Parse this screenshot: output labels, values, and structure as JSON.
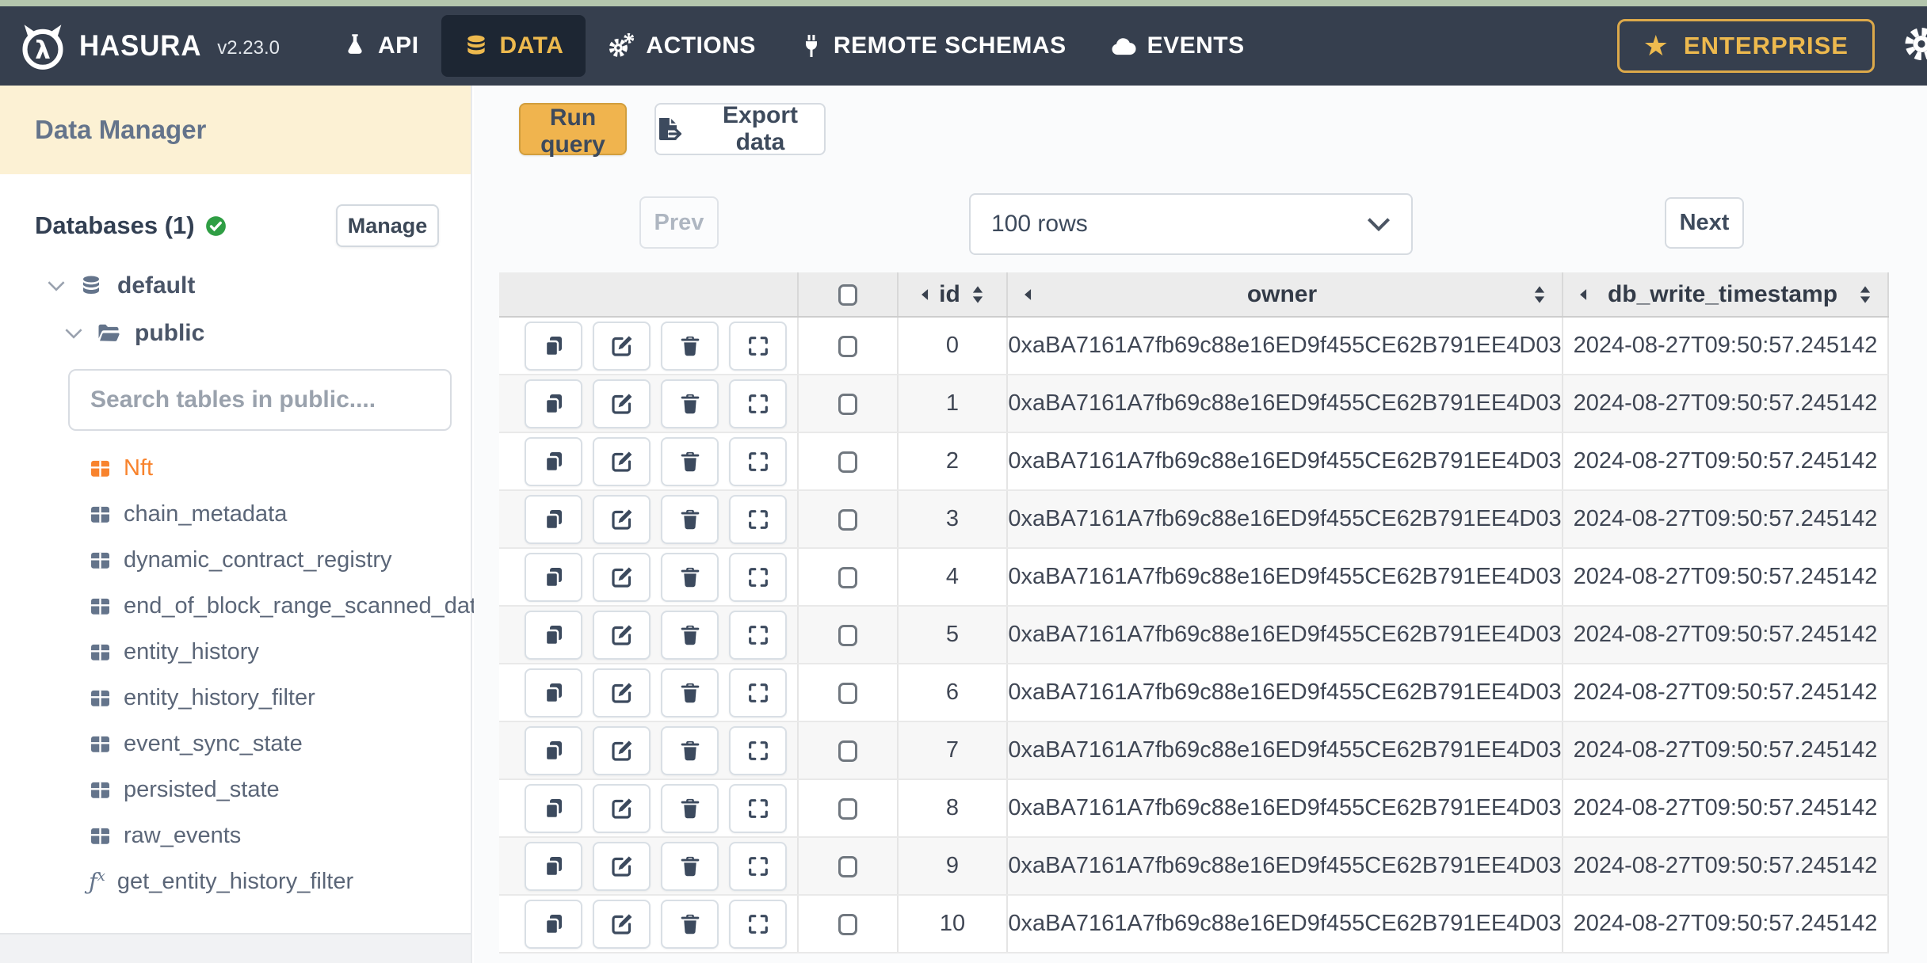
{
  "colors": {
    "accent_yellow": "#edb94e",
    "navbar_bg": "#363f4e",
    "navbar_active_bg": "#1d2633",
    "run_query_bg": "#f0b44e",
    "sidebar_header_bg": "#fcf1d4",
    "active_orange": "#f8832d",
    "success_green": "#2f9e44",
    "top_strip": "#b4c6ad"
  },
  "navbar": {
    "brand": "HASURA",
    "version": "v2.23.0",
    "items": [
      {
        "label": "API",
        "icon": "flask-icon",
        "active": false
      },
      {
        "label": "DATA",
        "icon": "database-icon",
        "active": true
      },
      {
        "label": "ACTIONS",
        "icon": "gears-icon",
        "active": false
      },
      {
        "label": "REMOTE SCHEMAS",
        "icon": "plug-icon",
        "active": false
      },
      {
        "label": "EVENTS",
        "icon": "cloud-icon",
        "active": false
      }
    ],
    "enterprise_label": "ENTERPRISE"
  },
  "sidebar": {
    "title": "Data Manager",
    "databases_label": "Databases (1)",
    "manage_label": "Manage",
    "tree": {
      "database": "default",
      "schema": "public"
    },
    "search_placeholder": "Search tables in public....",
    "tables": [
      {
        "label": "Nft",
        "icon": "table",
        "active": true
      },
      {
        "label": "chain_metadata",
        "icon": "table",
        "active": false
      },
      {
        "label": "dynamic_contract_registry",
        "icon": "table",
        "active": false
      },
      {
        "label": "end_of_block_range_scanned_data",
        "icon": "table",
        "active": false
      },
      {
        "label": "entity_history",
        "icon": "table",
        "active": false
      },
      {
        "label": "entity_history_filter",
        "icon": "table",
        "active": false
      },
      {
        "label": "event_sync_state",
        "icon": "table",
        "active": false
      },
      {
        "label": "persisted_state",
        "icon": "table",
        "active": false
      },
      {
        "label": "raw_events",
        "icon": "table",
        "active": false
      },
      {
        "label": "get_entity_history_filter",
        "icon": "function",
        "active": false
      }
    ]
  },
  "toolbar": {
    "run_query": "Run query",
    "export_data": "Export data"
  },
  "pagination": {
    "prev": "Prev",
    "rows_selected": "100 rows",
    "next": "Next"
  },
  "table": {
    "columns": [
      "id",
      "owner",
      "db_write_timestamp"
    ],
    "rows": [
      {
        "id": "0",
        "owner": "0xaBA7161A7fb69c88e16ED9f455CE62B791EE4D03",
        "db_write_timestamp": "2024-08-27T09:50:57.245142"
      },
      {
        "id": "1",
        "owner": "0xaBA7161A7fb69c88e16ED9f455CE62B791EE4D03",
        "db_write_timestamp": "2024-08-27T09:50:57.245142"
      },
      {
        "id": "2",
        "owner": "0xaBA7161A7fb69c88e16ED9f455CE62B791EE4D03",
        "db_write_timestamp": "2024-08-27T09:50:57.245142"
      },
      {
        "id": "3",
        "owner": "0xaBA7161A7fb69c88e16ED9f455CE62B791EE4D03",
        "db_write_timestamp": "2024-08-27T09:50:57.245142"
      },
      {
        "id": "4",
        "owner": "0xaBA7161A7fb69c88e16ED9f455CE62B791EE4D03",
        "db_write_timestamp": "2024-08-27T09:50:57.245142"
      },
      {
        "id": "5",
        "owner": "0xaBA7161A7fb69c88e16ED9f455CE62B791EE4D03",
        "db_write_timestamp": "2024-08-27T09:50:57.245142"
      },
      {
        "id": "6",
        "owner": "0xaBA7161A7fb69c88e16ED9f455CE62B791EE4D03",
        "db_write_timestamp": "2024-08-27T09:50:57.245142"
      },
      {
        "id": "7",
        "owner": "0xaBA7161A7fb69c88e16ED9f455CE62B791EE4D03",
        "db_write_timestamp": "2024-08-27T09:50:57.245142"
      },
      {
        "id": "8",
        "owner": "0xaBA7161A7fb69c88e16ED9f455CE62B791EE4D03",
        "db_write_timestamp": "2024-08-27T09:50:57.245142"
      },
      {
        "id": "9",
        "owner": "0xaBA7161A7fb69c88e16ED9f455CE62B791EE4D03",
        "db_write_timestamp": "2024-08-27T09:50:57.245142"
      },
      {
        "id": "10",
        "owner": "0xaBA7161A7fb69c88e16ED9f455CE62B791EE4D03",
        "db_write_timestamp": "2024-08-27T09:50:57.245142"
      }
    ]
  }
}
